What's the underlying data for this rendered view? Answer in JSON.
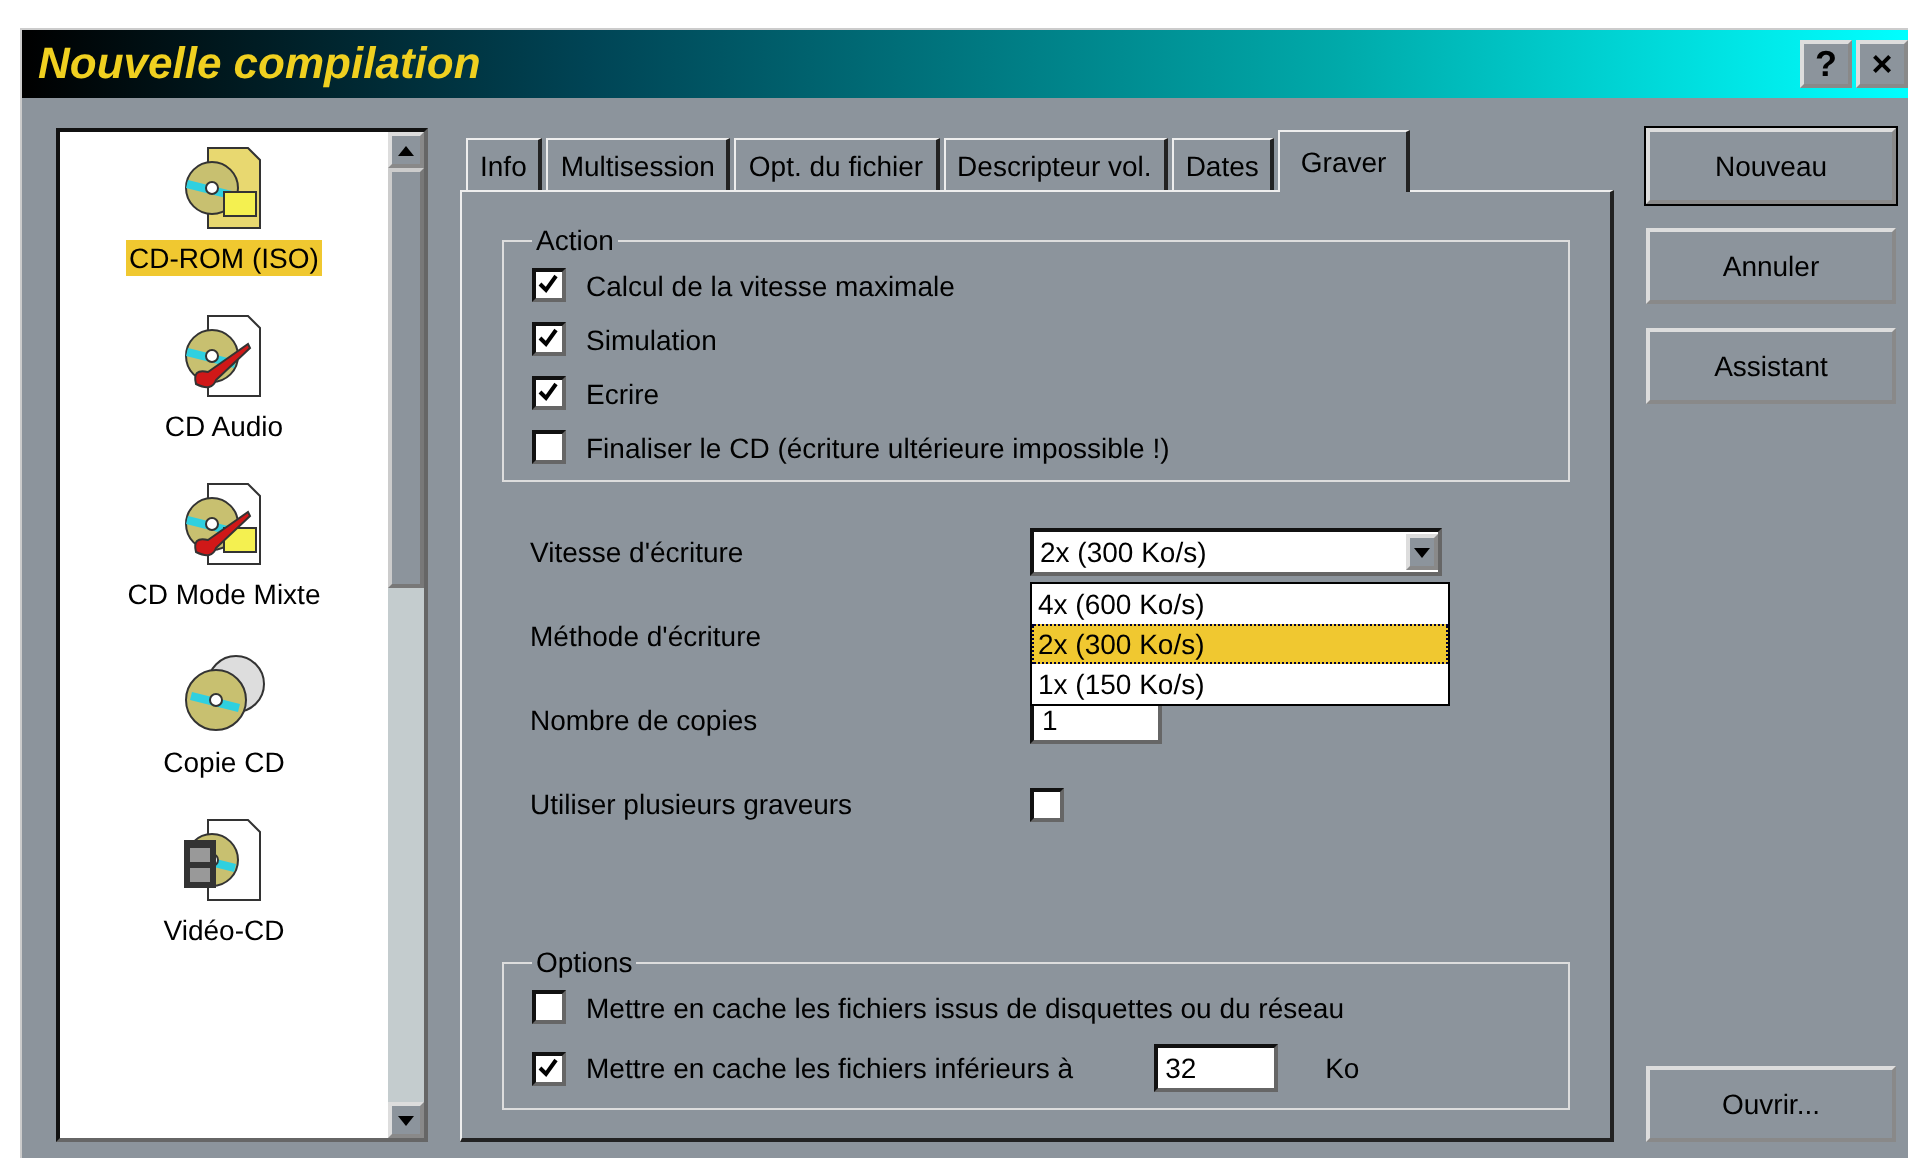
{
  "window": {
    "title": "Nouvelle compilation",
    "help": "?",
    "close": "×"
  },
  "sidebar": {
    "items": [
      {
        "label": "CD-ROM (ISO)",
        "kind": "iso",
        "selected": true
      },
      {
        "label": "CD Audio",
        "kind": "audio",
        "selected": false
      },
      {
        "label": "CD Mode Mixte",
        "kind": "mixed",
        "selected": false
      },
      {
        "label": "Copie CD",
        "kind": "copy",
        "selected": false
      },
      {
        "label": "Vidéo-CD",
        "kind": "video",
        "selected": false
      }
    ]
  },
  "tabs": [
    {
      "label": "Info",
      "selected": false
    },
    {
      "label": "Multisession",
      "selected": false
    },
    {
      "label": "Opt. du fichier",
      "selected": false
    },
    {
      "label": "Descripteur vol.",
      "selected": false
    },
    {
      "label": "Dates",
      "selected": false
    },
    {
      "label": "Graver",
      "selected": true
    }
  ],
  "action": {
    "title": "Action",
    "items": [
      {
        "label": "Calcul de la vitesse maximale",
        "checked": true
      },
      {
        "label": "Simulation",
        "checked": true
      },
      {
        "label": "Ecrire",
        "checked": true
      },
      {
        "label": "Finaliser le CD (écriture ultérieure impossible !)",
        "checked": false
      }
    ]
  },
  "speed": {
    "label": "Vitesse d'écriture",
    "value": "2x (300 Ko/s)",
    "options": [
      {
        "label": "4x (600 Ko/s)",
        "selected": false
      },
      {
        "label": "2x (300 Ko/s)",
        "selected": true
      },
      {
        "label": "1x (150 Ko/s)",
        "selected": false
      }
    ]
  },
  "method": {
    "label": "Méthode d'écriture"
  },
  "copies": {
    "label": "Nombre de copies",
    "value": "1"
  },
  "multi": {
    "label": "Utiliser plusieurs graveurs",
    "checked": false
  },
  "options": {
    "title": "Options",
    "items": [
      {
        "label": "Mettre en cache les fichiers issus de disquettes ou du réseau",
        "checked": false
      },
      {
        "label": "Mettre en cache les fichiers inférieurs à",
        "checked": true,
        "value": "32",
        "unit": "Ko"
      }
    ]
  },
  "buttons": [
    {
      "label": "Nouveau",
      "kind": "default"
    },
    {
      "label": "Annuler",
      "kind": "normal"
    },
    {
      "label": "Assistant",
      "kind": "normal"
    },
    {
      "label": "Ouvrir...",
      "kind": "bottom"
    }
  ]
}
